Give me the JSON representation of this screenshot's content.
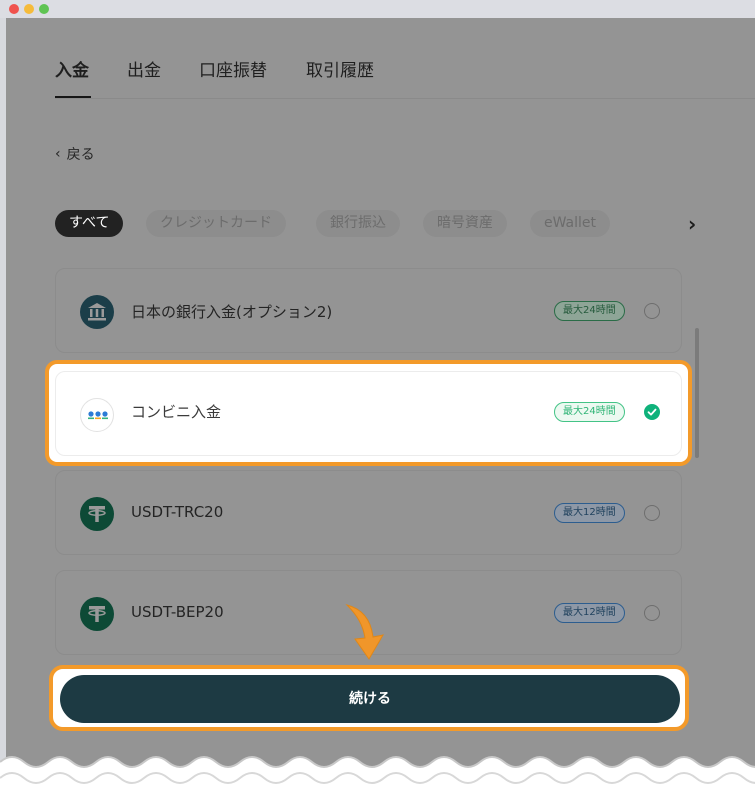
{
  "tabs": [
    {
      "label": "入金",
      "active": true
    },
    {
      "label": "出金",
      "active": false
    },
    {
      "label": "口座振替",
      "active": false
    },
    {
      "label": "取引履歴",
      "active": false
    }
  ],
  "back_label": "戻る",
  "filters": [
    {
      "label": "すべて",
      "active": true
    },
    {
      "label": "クレジットカード",
      "active": false
    },
    {
      "label": "銀行振込",
      "active": false
    },
    {
      "label": "暗号資産",
      "active": false
    },
    {
      "label": "eWallet",
      "active": false
    }
  ],
  "methods": [
    {
      "name": "日本の銀行入金(オプション2)",
      "badge": "最大24時間",
      "selected": false,
      "icon": "bank-icon"
    },
    {
      "name": "コンビニ入金",
      "badge": "最大24時間",
      "selected": true,
      "icon": "convenience-store-icon"
    },
    {
      "name": "USDT-TRC20",
      "badge": "最大12時間",
      "selected": false,
      "icon": "tether-icon"
    },
    {
      "name": "USDT-BEP20",
      "badge": "最大12時間",
      "selected": false,
      "icon": "tether-icon"
    }
  ],
  "continue_label": "続ける",
  "colors": {
    "highlight": "#f39a2a",
    "button": "#1d3a43",
    "success": "#0fb27b",
    "tether": "#0d7a58"
  }
}
